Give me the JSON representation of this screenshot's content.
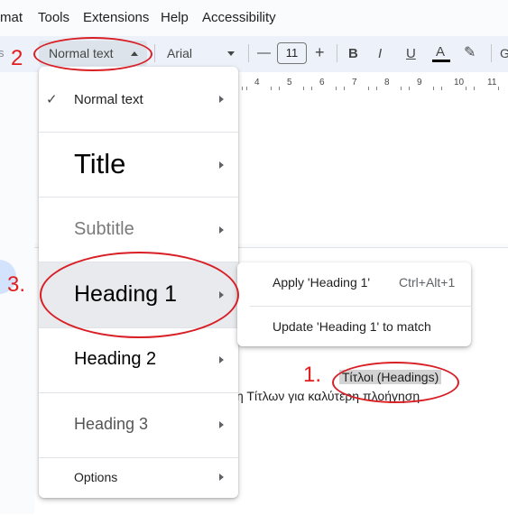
{
  "menubar": {
    "items": [
      "mat",
      "Tools",
      "Extensions",
      "Help",
      "Accessibility"
    ]
  },
  "toolbar": {
    "style_value": "Normal text",
    "font_value": "Arial",
    "minus": "—",
    "size_value": "11",
    "plus": "+",
    "bold": "B",
    "italic": "I",
    "underline": "U",
    "text_color": "A",
    "highlight": "✎",
    "left_edge": "s",
    "right_edge": "G"
  },
  "ruler": {
    "labels": [
      "4",
      "5",
      "6",
      "7",
      "8",
      "9",
      "10",
      "11"
    ]
  },
  "style_menu": {
    "items": [
      {
        "label": "Normal text",
        "checked": true
      },
      {
        "label": "Title"
      },
      {
        "label": "Subtitle"
      },
      {
        "label": "Heading 1"
      },
      {
        "label": "Heading 2"
      },
      {
        "label": "Heading 3"
      },
      {
        "label": "Options"
      }
    ],
    "check": "✓"
  },
  "submenu": {
    "apply": "Apply 'Heading 1'",
    "apply_shortcut": "Ctrl+Alt+1",
    "update": "Update 'Heading 1' to match"
  },
  "document": {
    "highlighted_text": "Τίτλοι (Headings)",
    "body_text": "η Τίτλων για καλύτερη πλοήγηση"
  },
  "annotations": {
    "one": "1.",
    "two": "2",
    "three": "3."
  },
  "colors": {
    "annotation": "#e11d1d",
    "toolbar_bg": "#edf2fa",
    "hover_bg": "#e8eaed"
  }
}
